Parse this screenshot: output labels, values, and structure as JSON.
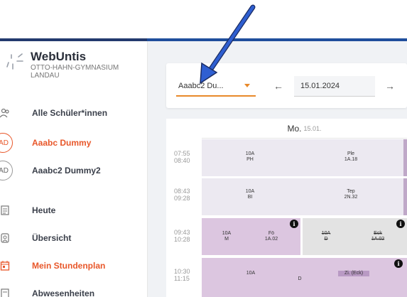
{
  "app": {
    "brand": "WebUntis",
    "school": "OTTO-HAHN-GYMNASIUM LANDAU"
  },
  "sidebar": {
    "items": [
      {
        "label": "Alle Schüler*innen",
        "icon": "students-icon",
        "badge": ""
      },
      {
        "label": "Aaabc Dummy",
        "icon": "avatar-icon",
        "badge": "AD",
        "active": true
      },
      {
        "label": "Aaabc2 Dummy2",
        "icon": "avatar-icon",
        "badge": "AD"
      },
      {
        "label": "Heute",
        "icon": "today-icon",
        "badge": ""
      },
      {
        "label": "Übersicht",
        "icon": "overview-icon",
        "badge": ""
      },
      {
        "label": "Mein Stundenplan",
        "icon": "calendar-icon",
        "badge": "",
        "active": true
      },
      {
        "label": "Abwesenheiten",
        "icon": "absence-icon",
        "badge": ""
      }
    ]
  },
  "toolbar": {
    "student_select_value": "Aaabc2 Du...",
    "prev_label": "←",
    "date_value": "15.01.2024",
    "next_label": "→"
  },
  "timetable": {
    "day_label": "Mo.",
    "day_date": "15.01.",
    "periods": [
      {
        "start": "07:55",
        "end": "08:40"
      },
      {
        "start": "08:43",
        "end": "09:28"
      },
      {
        "start": "09:43",
        "end": "10:28"
      },
      {
        "start": "10:30",
        "end": "11:15"
      }
    ],
    "lessons": {
      "p1a": {
        "class": "10A",
        "subject": "PH"
      },
      "p1b": {
        "teacher": "Ple",
        "room": "1A.18"
      },
      "p2a": {
        "class": "10A",
        "subject": "BI"
      },
      "p2b": {
        "teacher": "Tep",
        "room": "2N.32"
      },
      "p3a": {
        "class": "10A",
        "subject": "M"
      },
      "p3b": {
        "teacher": "Fö",
        "room": "1A.02"
      },
      "p3c": {
        "class": "10A",
        "subject": "D"
      },
      "p3d": {
        "teacher": "Eck",
        "room": "1A.02"
      },
      "p4a": {
        "class": "10A",
        "subject": "D"
      },
      "p4b": {
        "teacher": "Zi. (Eck)"
      }
    },
    "colors": {
      "normal": "#ece9f1",
      "substitution": "#dcc6e0",
      "cancelled": "#e3e3e3",
      "accent": "#e8572a"
    }
  },
  "annotation": {
    "color": "#2f5fd1",
    "icon": "pointer-arrow-icon"
  }
}
